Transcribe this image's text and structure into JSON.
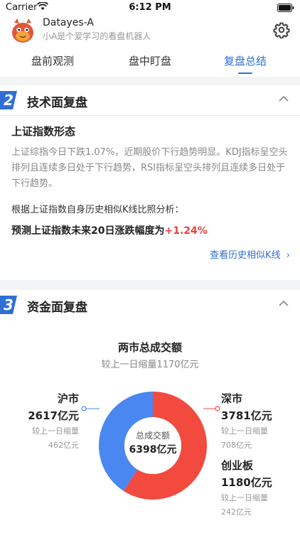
{
  "status": {
    "carrier": "Carrier",
    "time": "6:12 PM"
  },
  "header": {
    "name": "Datayes-A",
    "subtitle": "小A是个爱学习的看盘机器人"
  },
  "tabs": [
    {
      "label": "盘前观测"
    },
    {
      "label": "盘中盯盘"
    },
    {
      "label": "复盘总结"
    }
  ],
  "active_tab": "复盘总结",
  "accent_color": "#2f6fd6",
  "section1": {
    "number": "2",
    "title": "技术面复盘",
    "subtitle": "上证指数形态",
    "description": "上证综指今日下跌1.07%，近期股价下行趋势明显。KDJ指标呈空头排列且连续多日处于下行趋势，RSI指标呈空头排列且连续多日处于下行趋势。",
    "basis": "根据上证指数自身历史相似K线比照分析：",
    "forecast_prefix": "预测上证指数未来20日涨跌幅度为",
    "forecast_value": "+1.24%",
    "link": "查看历史相似K线",
    "link_arrow": "›"
  },
  "section2": {
    "number": "3",
    "title": "资金面复盘",
    "chart_title": "两市总成交额",
    "chart_subtitle": "较上一日缩量1170亿元",
    "center_label": "总成交额",
    "center_value": "6398亿元"
  },
  "chart_data": {
    "type": "pie",
    "title": "两市总成交额",
    "subtitle": "较上一日缩量1170亿元",
    "center_label": "总成交额",
    "center_value": "6398亿元",
    "slices": [
      {
        "name": "沪市",
        "value": 2617,
        "value_label": "2617亿元",
        "caption": "较上一日缩量",
        "change_label": "462亿元",
        "color": "#4a87f0"
      },
      {
        "name": "深市",
        "value": 3781,
        "value_label": "3781亿元",
        "caption": "较上一日缩量",
        "change_label": "708亿元",
        "color": "#f24a3f"
      }
    ],
    "extra": {
      "name": "创业板",
      "value": 1180,
      "value_label": "1180亿元",
      "caption": "较上一日缩量",
      "change_label": "242亿元"
    }
  }
}
